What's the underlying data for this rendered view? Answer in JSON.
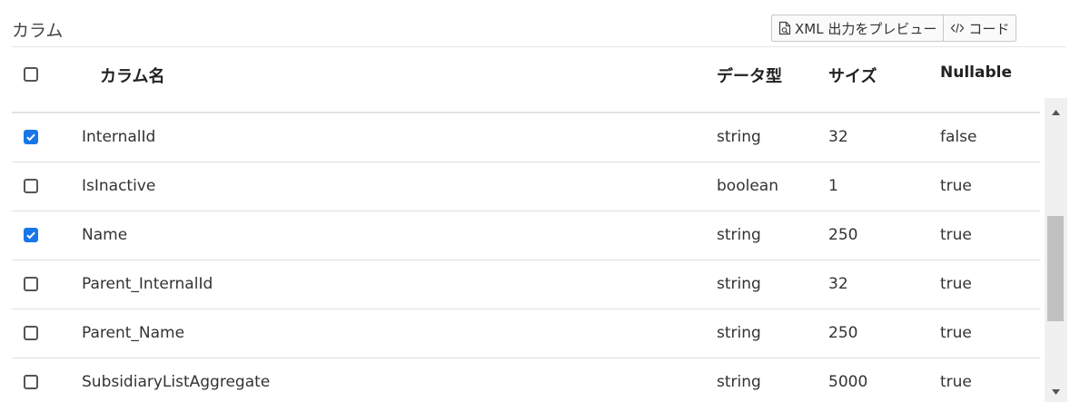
{
  "section": {
    "title": "カラム"
  },
  "toolbar": {
    "xml_preview_label": "XML 出力をプレビュー",
    "code_label": "コード"
  },
  "table": {
    "headers": {
      "name": "カラム名",
      "type": "データ型",
      "size": "サイズ",
      "nullable": "Nullable"
    },
    "rows": [
      {
        "checked": true,
        "name": "InternalId",
        "type": "string",
        "size": "32",
        "nullable": "false"
      },
      {
        "checked": false,
        "name": "IsInactive",
        "type": "boolean",
        "size": "1",
        "nullable": "true"
      },
      {
        "checked": true,
        "name": "Name",
        "type": "string",
        "size": "250",
        "nullable": "true"
      },
      {
        "checked": false,
        "name": "Parent_InternalId",
        "type": "string",
        "size": "32",
        "nullable": "true"
      },
      {
        "checked": false,
        "name": "Parent_Name",
        "type": "string",
        "size": "250",
        "nullable": "true"
      },
      {
        "checked": false,
        "name": "SubsidiaryListAggregate",
        "type": "string",
        "size": "5000",
        "nullable": "true"
      }
    ]
  },
  "colors": {
    "accent": "#1877e8",
    "checkbox_border": "#555555"
  },
  "icons": {
    "xml_preview": "document-preview-icon",
    "code": "code-brackets-icon",
    "scroll_up": "caret-up-icon",
    "scroll_down": "caret-down-icon"
  }
}
